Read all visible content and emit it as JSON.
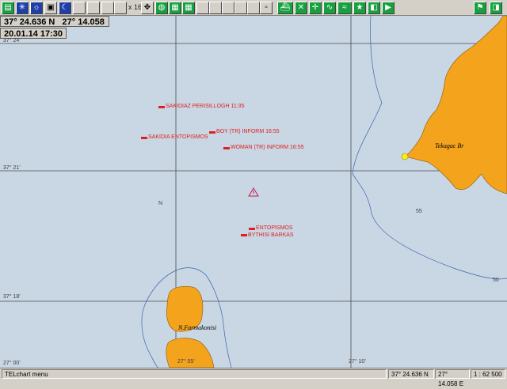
{
  "position": {
    "lat": "37° 24.636 N",
    "lon": "27° 14.058 E"
  },
  "datetime": "20.01.14  17:30",
  "toolbar": {
    "zoom_label": "x 16"
  },
  "grid_labels": {
    "lat_top": "37° 24'",
    "lat_mid": "37° 21'",
    "lat_low": "37° 18'",
    "lon_left": "27° 00'",
    "lon_mid": "27° 05'",
    "lon_right": "27° 10'"
  },
  "markers": [
    {
      "text": "SAKIDIAZ PERISILLOGH 11:35"
    },
    {
      "text": "BOY (TR) INFORM 16:55"
    },
    {
      "text": "SAKIDIA ENTOPISMOS"
    },
    {
      "text": "WOMAN (TR) INFORM 16:55"
    },
    {
      "text": "ENTOPISMOS"
    },
    {
      "text": "BYTHISI BARKAS"
    }
  ],
  "places": {
    "east": "Tekagac Br",
    "south": "N.Farmakonisi"
  },
  "depth_labels": {
    "d1": "N",
    "d2": "55",
    "d3": "50"
  },
  "status_bar": {
    "menu": "TELchart menu",
    "lat": "37° 24.636 N",
    "lon": "27° 14.058 E",
    "scale": "1 : 62 500"
  },
  "colors": {
    "sea": "#c9d6e3",
    "land": "#f3a31c",
    "marker": "#e02020",
    "chrome": "#d4d0c8"
  }
}
